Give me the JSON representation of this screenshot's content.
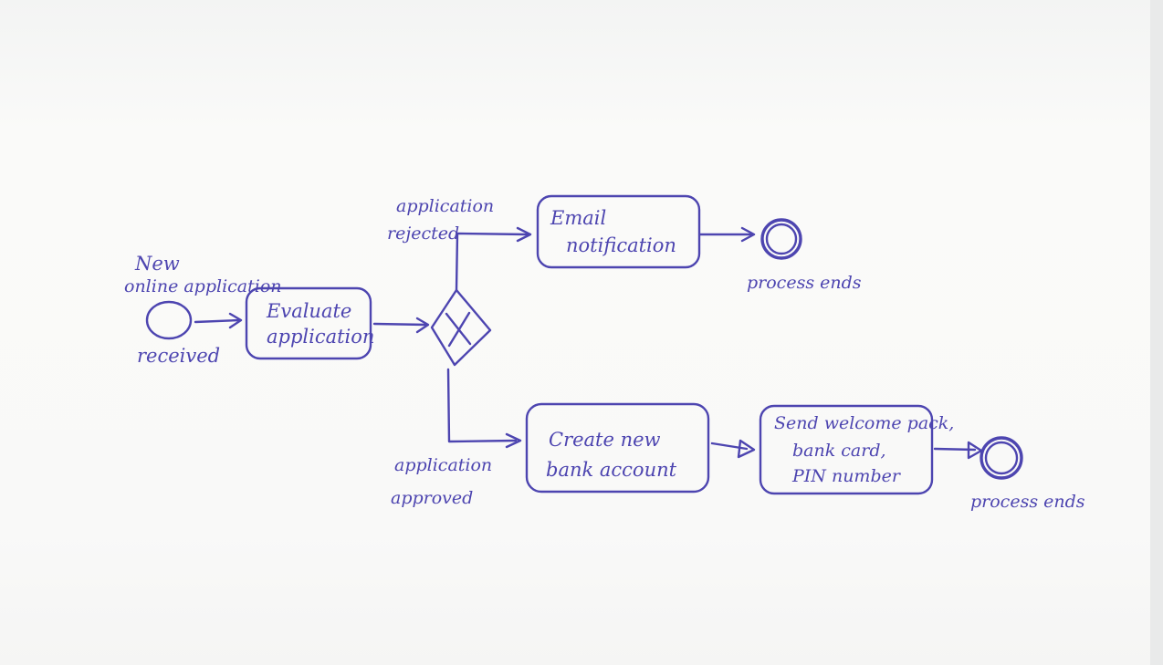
{
  "diagram": {
    "start_event": {
      "label_line1": "New",
      "label_line2": "online application",
      "label_line3": "received"
    },
    "tasks": {
      "evaluate": {
        "line1": "Evaluate",
        "line2": "application"
      },
      "email": {
        "line1": "Email",
        "line2": "notification"
      },
      "create_account": {
        "line1": "Create new",
        "line2": "bank account"
      },
      "send_pack": {
        "line1": "Send welcome pack,",
        "line2": "bank card,",
        "line3": "PIN number"
      }
    },
    "gateway": {
      "rejected_line1": "application",
      "rejected_line2": "rejected",
      "approved_line1": "application",
      "approved_line2": "approved"
    },
    "end_events": {
      "top": "process ends",
      "bottom": "process ends"
    },
    "colors": {
      "ink": "#4d45b0",
      "paper": "#f7f7f6"
    }
  }
}
